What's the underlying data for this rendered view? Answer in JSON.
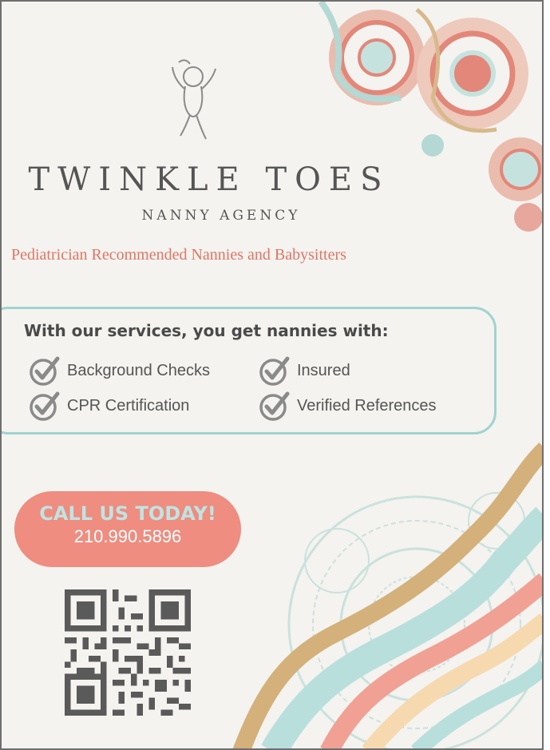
{
  "brand": {
    "name": "TWINKLE TOES",
    "subtitle": "NANNY AGENCY"
  },
  "tagline": "Pediatrician Recommended Nannies and Babysitters",
  "services": {
    "title": "With our services, you get nannies with:",
    "items": [
      {
        "label": "Background Checks",
        "icon": "check-circle-icon"
      },
      {
        "label": "Insured",
        "icon": "check-circle-icon"
      },
      {
        "label": "CPR Certification",
        "icon": "check-circle-icon"
      },
      {
        "label": "Verified References",
        "icon": "check-circle-icon"
      }
    ]
  },
  "cta": {
    "title": "CALL US TODAY!",
    "phone": "210.990.5896"
  },
  "colors": {
    "background": "#f4f3ef",
    "accent_coral": "#ee8d80",
    "accent_teal": "#9fd3d0",
    "accent_tan": "#d4b07a",
    "accent_peach": "#f7d9b0",
    "text_gray": "#555555"
  }
}
